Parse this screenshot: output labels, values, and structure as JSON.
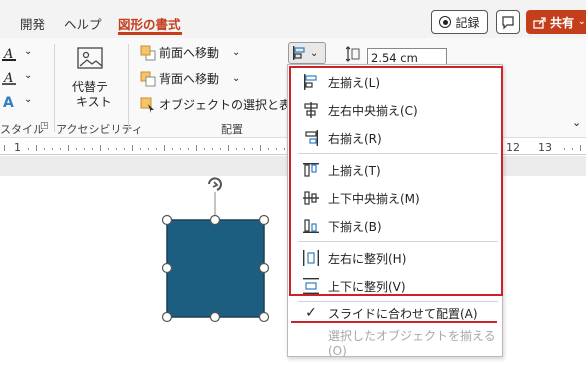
{
  "tabs": [
    {
      "label": "開発"
    },
    {
      "label": "ヘルプ"
    },
    {
      "label": "図形の書式"
    }
  ],
  "header": {
    "record_label": "記録",
    "share_label": "共有"
  },
  "ribbon": {
    "style_group_label": "スタイル",
    "accessibility_group_label": "アクセシビリティ",
    "alt_text_line1": "代替テ",
    "alt_text_line2": "キスト",
    "bring_forward_label": "前面へ移動",
    "send_backward_label": "背面へ移動",
    "selection_pane_label": "オブジェクトの選択と表示",
    "arrange_group_label": "配置",
    "size_height_value": "2.54 cm"
  },
  "ruler": {
    "numbers_left": [
      "1"
    ],
    "numbers_right": [
      "12",
      "13"
    ]
  },
  "align_menu": {
    "items": [
      {
        "label": "左揃え(L)"
      },
      {
        "label": "左右中央揃え(C)"
      },
      {
        "label": "右揃え(R)"
      },
      {
        "label": "上揃え(T)"
      },
      {
        "label": "上下中央揃え(M)"
      },
      {
        "label": "下揃え(B)"
      },
      {
        "label": "左右に整列(H)"
      },
      {
        "label": "上下に整列(V)"
      }
    ],
    "align_to_slide_label": "スライドに合わせて配置(A)",
    "align_selected_label": "選択したオブジェクトを揃える(O)"
  },
  "colors": {
    "accent": "#c43e1c",
    "shape_fill": "#1b5e80",
    "highlight": "#d0202a"
  }
}
